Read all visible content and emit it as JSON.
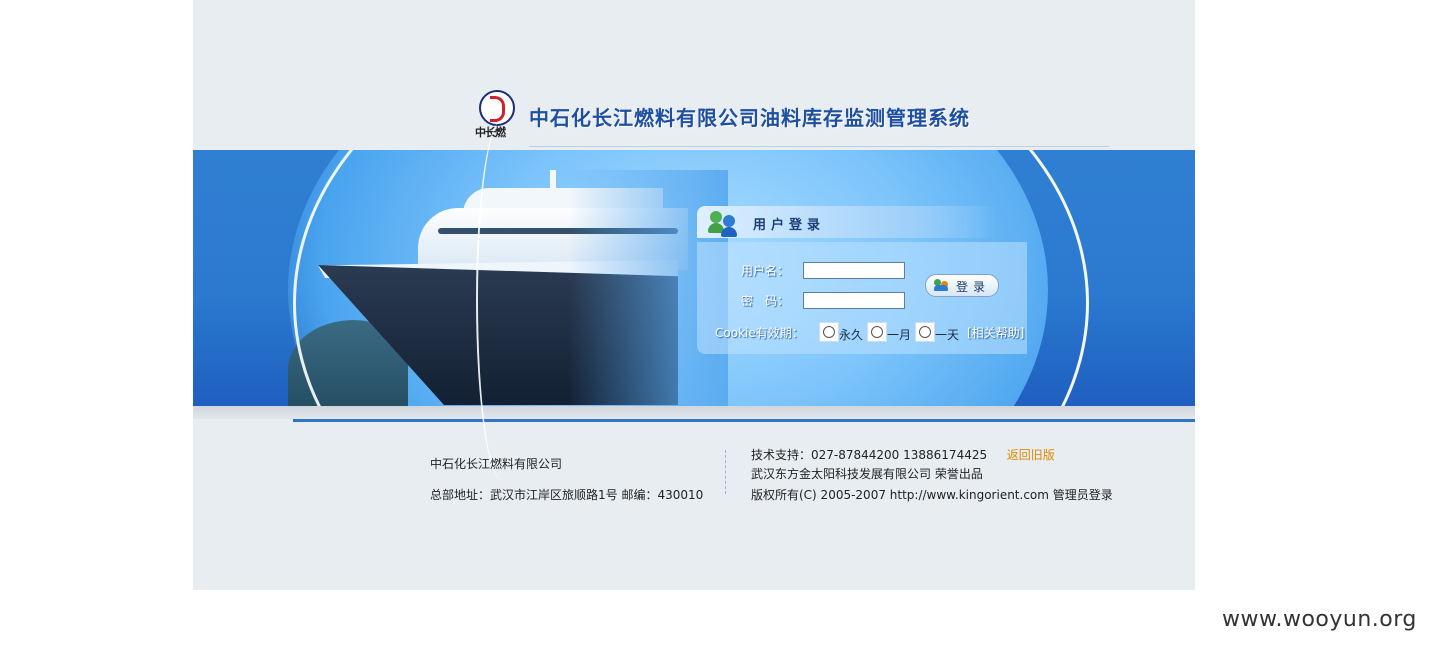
{
  "header": {
    "logo_text": "中长燃",
    "system_title": "中石化长江燃料有限公司油料库存监测管理系统"
  },
  "login": {
    "title": "用户登录",
    "username_label": "用户名：",
    "password_label": "密　码：",
    "username_value": "",
    "password_value": "",
    "login_button": "登录",
    "cookie_label": "Cookie有效期：",
    "cookie_options": [
      "永久",
      "一月",
      "一天"
    ],
    "help_link": "[相关帮助]"
  },
  "footer": {
    "company": "中石化长江燃料有限公司",
    "address": "总部地址：武汉市江岸区旅顺路1号  邮编：430010",
    "tech_support": "技术支持：027-87844200 13886174425",
    "old_version_link": "返回旧版",
    "producer": "武汉东方金太阳科技发展有限公司  荣誉出品",
    "copyright": "版权所有(C) 2005-2007 http://www.kingorient.com",
    "admin_login_link": "管理员登录"
  },
  "watermark": "www.wooyun.org",
  "colors": {
    "brand_blue": "#1e4fa0",
    "band_blue": "#2b7ad0",
    "link_orange": "#e08a00"
  }
}
